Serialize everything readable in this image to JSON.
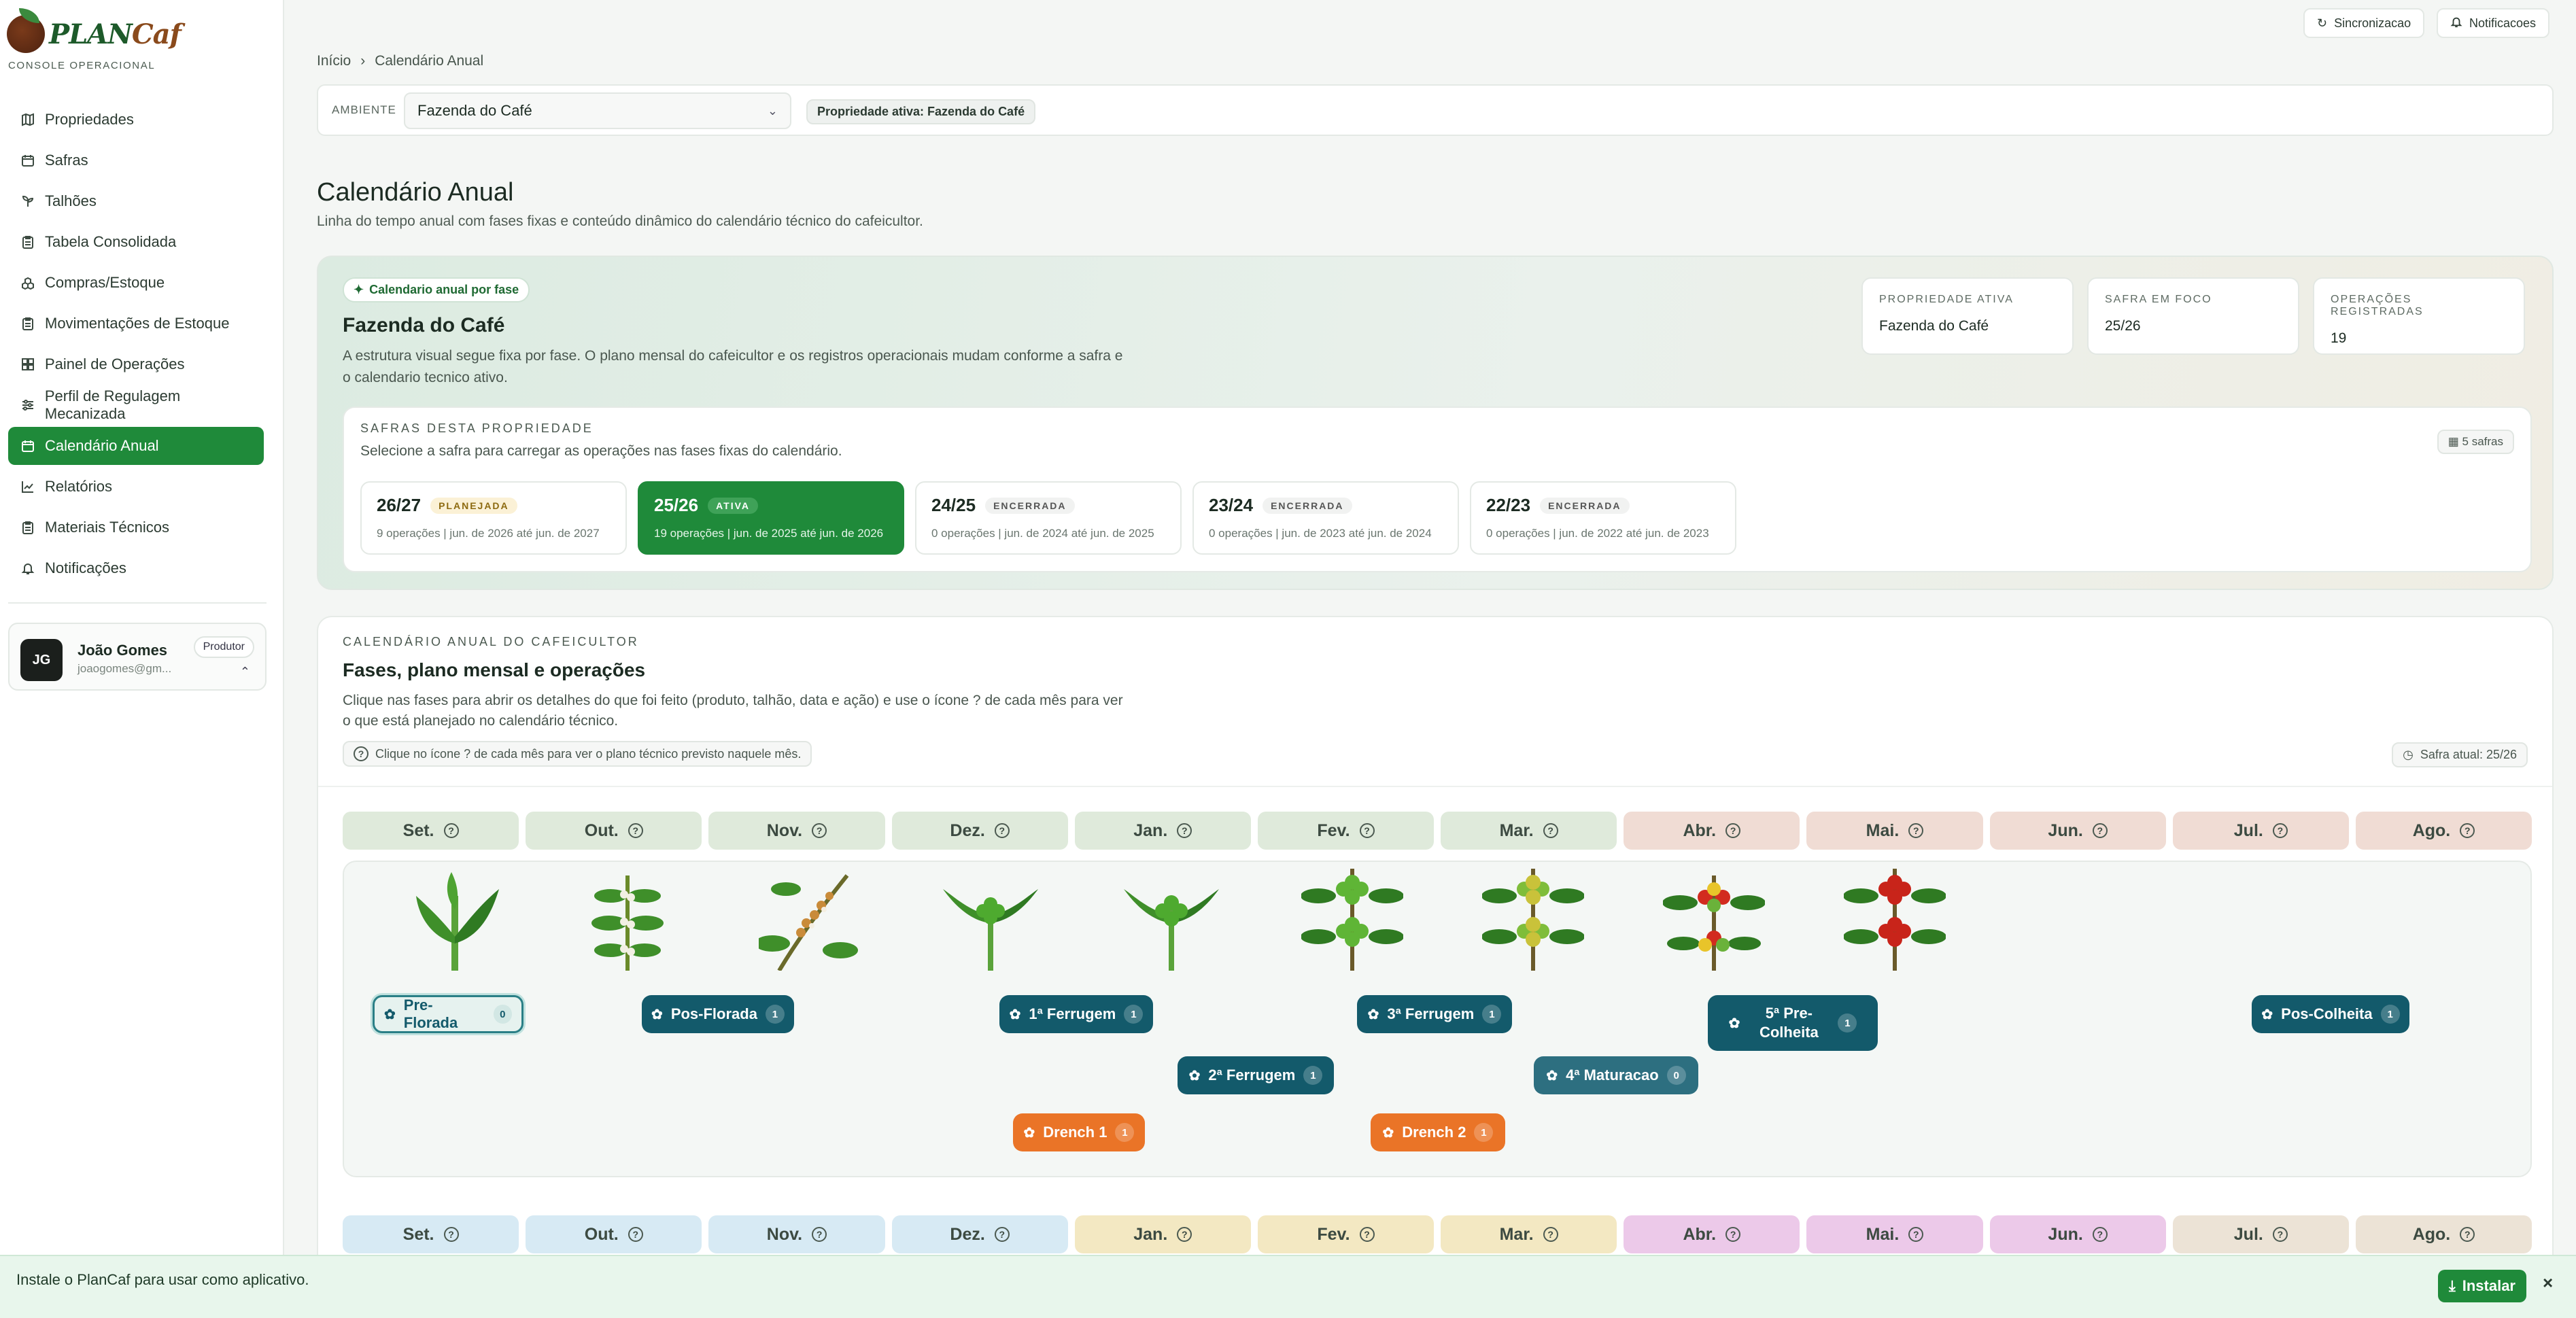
{
  "brand": {
    "name_a": "PLAN",
    "name_b": "Caf",
    "subtitle": "CONSOLE OPERACIONAL"
  },
  "sidebar": {
    "items": [
      {
        "label": "Propriedades",
        "icon": "map-icon"
      },
      {
        "label": "Safras",
        "icon": "calendar-icon"
      },
      {
        "label": "Talhões",
        "icon": "sprout-icon"
      },
      {
        "label": "Tabela Consolidada",
        "icon": "clipboard-icon"
      },
      {
        "label": "Compras/Estoque",
        "icon": "boxes-icon"
      },
      {
        "label": "Movimentações de Estoque",
        "icon": "clipboard-icon"
      },
      {
        "label": "Painel de Operações",
        "icon": "grid-icon"
      },
      {
        "label": "Perfil de Regulagem Mecanizada",
        "icon": "sliders-icon"
      },
      {
        "label": "Calendário Anual",
        "icon": "calendar-icon",
        "active": true
      },
      {
        "label": "Relatórios",
        "icon": "chart-line-icon"
      },
      {
        "label": "Materiais Técnicos",
        "icon": "clipboard-icon"
      },
      {
        "label": "Notificações",
        "icon": "bell-icon"
      }
    ],
    "user": {
      "initials": "JG",
      "name": "João Gomes",
      "email": "joaogomes@gm...",
      "role": "Produtor"
    }
  },
  "topbar": {
    "sync_label": "Sincronizacao",
    "notif_label": "Notificacoes"
  },
  "breadcrumb": {
    "home": "Início",
    "current": "Calendário Anual"
  },
  "env": {
    "label": "AMBIENTE",
    "value": "Fazenda do Café",
    "badge": "Propriedade ativa: Fazenda do Café"
  },
  "page": {
    "title": "Calendário Anual",
    "subtitle": "Linha do tempo anual com fases fixas e conteúdo dinâmico do calendário técnico do cafeicultor."
  },
  "hero": {
    "pill": "Calendario anual por fase",
    "title": "Fazenda do Café",
    "text": "A estrutura visual segue fixa por fase. O plano mensal do cafeicultor e os registros operacionais mudam conforme a safra e o calendario tecnico ativo.",
    "stats": [
      {
        "label": "PROPRIEDADE ATIVA",
        "value": "Fazenda do Café"
      },
      {
        "label": "SAFRA EM FOCO",
        "value": "25/26"
      },
      {
        "label": "OPERAÇÕES REGISTRADAS",
        "value": "19"
      }
    ],
    "safras_label": "SAFRAS DESTA PROPRIEDADE",
    "safras_sub": "Selecione a safra para carregar as operações nas fases fixas do calendário.",
    "safras_count": "5 safras",
    "safras": [
      {
        "name": "26/27",
        "status": "PLANEJADA",
        "meta": "9 operações | jun. de 2026 até jun. de 2027"
      },
      {
        "name": "25/26",
        "status": "ATIVA",
        "meta": "19 operações | jun. de 2025 até jun. de 2026"
      },
      {
        "name": "24/25",
        "status": "ENCERRADA",
        "meta": "0 operações | jun. de 2024 até jun. de 2025"
      },
      {
        "name": "23/24",
        "status": "ENCERRADA",
        "meta": "0 operações | jun. de 2023 até jun. de 2024"
      },
      {
        "name": "22/23",
        "status": "ENCERRADA",
        "meta": "0 operações | jun. de 2022 até jun. de 2023"
      }
    ]
  },
  "calendar": {
    "label": "CALENDÁRIO ANUAL DO CAFEICULTOR",
    "title": "Fases, plano mensal e operações",
    "text": "Clique nas fases para abrir os detalhes do que foi feito (produto, talhão, data e ação) e use o ícone ? de cada mês para ver o que está planejado no calendário técnico.",
    "hint": "Clique no ícone ? de cada mês para ver o plano técnico previsto naquele mês.",
    "safra_atual": "Safra atual: 25/26",
    "months": [
      "Set.",
      "Out.",
      "Nov.",
      "Dez.",
      "Jan.",
      "Fev.",
      "Mar.",
      "Abr.",
      "Mai.",
      "Jun.",
      "Jul.",
      "Ago."
    ],
    "month_colors_row1": [
      "#dfeadb",
      "#dfeadb",
      "#dfeadb",
      "#dfeadb",
      "#dfeadb",
      "#dfeadb",
      "#dfeadb",
      "#f0dcd4",
      "#f0dcd4",
      "#f0dcd4",
      "#f0dcd4",
      "#f0dcd4"
    ],
    "month_colors_row2": [
      "#d7eaf4",
      "#d7eaf4",
      "#d7eaf4",
      "#d7eaf4",
      "#f3e8c2",
      "#f3e8c2",
      "#f3e8c2",
      "#ecc9e9",
      "#ecc9e9",
      "#ecc9e9",
      "#ece3d6",
      "#ece3d6"
    ],
    "phases": [
      {
        "label": "Pre-Florada",
        "count": "0"
      },
      {
        "label": "Pos-Florada",
        "count": "1"
      },
      {
        "label": "1ª Ferrugem",
        "count": "1"
      },
      {
        "label": "3ª Ferrugem",
        "count": "1"
      },
      {
        "label": "5ª Pre-Colheita",
        "count": "1"
      },
      {
        "label": "Pos-Colheita",
        "count": "1"
      },
      {
        "label": "2ª Ferrugem",
        "count": "1"
      },
      {
        "label": "4ª Maturacao",
        "count": "0"
      },
      {
        "label": "Drench 1",
        "count": "1"
      },
      {
        "label": "Drench 2",
        "count": "1"
      }
    ]
  },
  "install": {
    "text": "Instale o PlanCaf para usar como aplicativo.",
    "button": "Instalar",
    "close": "×"
  }
}
